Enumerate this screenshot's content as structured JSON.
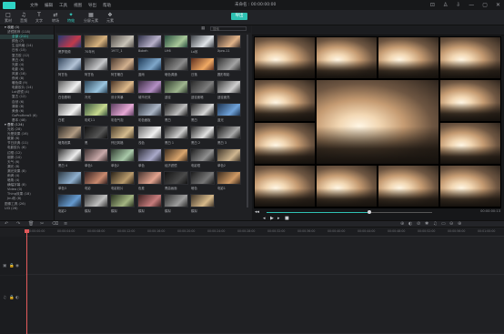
{
  "app": {
    "title": "未命名 : 00:00:00:00",
    "menu": [
      "文件",
      "编辑",
      "工具",
      "视图",
      "导出",
      "帮助"
    ],
    "win_controls": [
      "⊡",
      "♙",
      "⇩",
      "—",
      "▢",
      "✕"
    ]
  },
  "toolbar": {
    "items": [
      {
        "label": "素材",
        "icon": "□"
      },
      {
        "label": "音频",
        "icon": "♫"
      },
      {
        "label": "文字",
        "icon": "T"
      },
      {
        "label": "转场",
        "icon": "⇄"
      },
      {
        "label": "特效",
        "icon": "✦"
      },
      {
        "label": "分屏元素",
        "icon": "▦"
      },
      {
        "label": "元素",
        "icon": "❖"
      }
    ],
    "active_index": 4,
    "export_label": "导出"
  },
  "sidebar": {
    "items": [
      {
        "label": "▾ 收藏 (0)",
        "level": 0,
        "hdr": true
      },
      {
        "label": "滤镜推荐 (118)",
        "level": 1
      },
      {
        "label": "全部 (212)",
        "level": 2,
        "sel": true
      },
      {
        "label": "颜色 (7)",
        "level": 2
      },
      {
        "label": "生活风格 (14)",
        "level": 2
      },
      {
        "label": "日系 (15)",
        "level": 2
      },
      {
        "label": "复古胶 (12)",
        "level": 2
      },
      {
        "label": "黑白 (8)",
        "level": 2
      },
      {
        "label": "光影 (4)",
        "level": 2
      },
      {
        "label": "电影 (8)",
        "level": 2
      },
      {
        "label": "风景 (18)",
        "level": 2
      },
      {
        "label": "夜间 (8)",
        "level": 2
      },
      {
        "label": "暖色调 (9)",
        "level": 2
      },
      {
        "label": "电影胶片 (14)",
        "level": 2
      },
      {
        "label": "Lut滤镜 (4)",
        "level": 2
      },
      {
        "label": "复古 (12)",
        "level": 2
      },
      {
        "label": "自然 (6)",
        "level": 2
      },
      {
        "label": "清新 (8)",
        "level": 2
      },
      {
        "label": "美食 (6)",
        "level": 2
      },
      {
        "label": "GoProHero5 (6)",
        "level": 2
      },
      {
        "label": "基本 (48)",
        "level": 2
      },
      {
        "label": "▾ 叠覆 (124)",
        "level": 0,
        "hdr": true
      },
      {
        "label": "光效 (28)",
        "level": 1
      },
      {
        "label": "光晕效果 (16)",
        "level": 1
      },
      {
        "label": "散景 (6)",
        "level": 1
      },
      {
        "label": "节日庆典 (11)",
        "level": 1
      },
      {
        "label": "电影胶片 (6)",
        "level": 1
      },
      {
        "label": "边框 (12)",
        "level": 1
      },
      {
        "label": "烟雾 (10)",
        "level": 1
      },
      {
        "label": "天气 (6)",
        "level": 1
      },
      {
        "label": "漏光 (8)",
        "level": 1
      },
      {
        "label": "漏光效果 (8)",
        "level": 1
      },
      {
        "label": "雨滴 (4)",
        "level": 1
      },
      {
        "label": "暗角 (4)",
        "level": 1
      },
      {
        "label": "横幅字幕 (8)",
        "level": 1
      },
      {
        "label": "Video (0)",
        "level": 1
      },
      {
        "label": "Thing效果 (18)",
        "level": 1
      },
      {
        "label": "Jnu效 (8)",
        "level": 1
      },
      {
        "label": "图像工具 (26)",
        "level": 0
      },
      {
        "label": "UI3 (26)",
        "level": 0
      }
    ]
  },
  "browser": {
    "search_placeholder": "搜索",
    "thumbnails": [
      {
        "label": "黑梦视频",
        "a": "#243a73",
        "b": "#c23a4b"
      },
      {
        "label": "70年代",
        "a": "#4a3b2c",
        "b": "#d7b27e"
      },
      {
        "label": "1977_1",
        "a": "#514c47",
        "b": "#c8c3b8"
      },
      {
        "label": "Bokeh",
        "a": "#2c2d45",
        "b": "#b7b0c9"
      },
      {
        "label": "LH6",
        "a": "#274c3d",
        "b": "#a9c89a"
      },
      {
        "label": "Lo效",
        "a": "#3b3f44",
        "b": "#dfe3e7"
      },
      {
        "label": "Xpro-11",
        "a": "#3c2f2a",
        "b": "#e0b389"
      },
      {
        "label": "阿甘色",
        "a": "#34475d",
        "b": "#b3c3d6"
      },
      {
        "label": "阿甘色",
        "a": "#3d3e40",
        "b": "#c6c7c9"
      },
      {
        "label": "阿甘暖白",
        "a": "#47362c",
        "b": "#d2b08f"
      },
      {
        "label": "蓝雨",
        "a": "#1e3a57",
        "b": "#7ea6c9"
      },
      {
        "label": "暗色调通",
        "a": "#2d2d2d",
        "b": "#8a8a8a"
      },
      {
        "label": "日落",
        "a": "#5c2e1e",
        "b": "#f0a964"
      },
      {
        "label": "圆形阴影",
        "a": "#313131",
        "b": "#a3a3a3"
      },
      {
        "label": "白色照明",
        "a": "#5a5a5a",
        "b": "#f0f0f0"
      },
      {
        "label": "冷光",
        "a": "#2a4458",
        "b": "#9cc6e0"
      },
      {
        "label": "设计风暴",
        "a": "#4a3526",
        "b": "#ddb98b"
      },
      {
        "label": "城市光效",
        "a": "#3a2a40",
        "b": "#b38fc4"
      },
      {
        "label": "迷径",
        "a": "#2e3a2c",
        "b": "#9fb58f"
      },
      {
        "label": "迷径面暗",
        "a": "#2a2a2a",
        "b": "#7c7c7c"
      },
      {
        "label": "迷径面亮",
        "a": "#3d3d3d",
        "b": "#cfcfcf"
      },
      {
        "label": "白框",
        "a": "#6a6a6a",
        "b": "#f2f2f2"
      },
      {
        "label": "彩虹11",
        "a": "#36503c",
        "b": "#c7d98f"
      },
      {
        "label": "彩色气泡",
        "a": "#5a3d5e",
        "b": "#e6a9d5"
      },
      {
        "label": "彩色面板",
        "a": "#30363f",
        "b": "#aab5c5"
      },
      {
        "label": "黑白",
        "a": "#1e1e1e",
        "b": "#bdbdbd"
      },
      {
        "label": "黑白",
        "a": "#262626",
        "b": "#d6d6d6"
      },
      {
        "label": "蓝光",
        "a": "#1d3350",
        "b": "#6fa2d9"
      },
      {
        "label": "暗角效果",
        "a": "#2c2824",
        "b": "#b09a82"
      },
      {
        "label": "黑",
        "a": "#101010",
        "b": "#555555"
      },
      {
        "label": "怀旧风格",
        "a": "#4a3d2a",
        "b": "#d4bb8e"
      },
      {
        "label": "浅色",
        "a": "#6c6c6c",
        "b": "#efefef"
      },
      {
        "label": "黑白 1",
        "a": "#222222",
        "b": "#cccccc"
      },
      {
        "label": "黑白 2",
        "a": "#2a2a2a",
        "b": "#e0e0e0"
      },
      {
        "label": "黑白 3",
        "a": "#1a1a1a",
        "b": "#a8a8a8"
      },
      {
        "label": "黑白 4",
        "a": "#303030",
        "b": "#ededed"
      },
      {
        "label": "单色1",
        "a": "#3b2f2f",
        "b": "#c9a9a9"
      },
      {
        "label": "单色2",
        "a": "#2f3b2f",
        "b": "#a9c9a9"
      },
      {
        "label": "单色",
        "a": "#2f2f3b",
        "b": "#a9a9c9"
      },
      {
        "label": "经济滤镜",
        "a": "#3d2c1e",
        "b": "#d9a56e"
      },
      {
        "label": "电影框",
        "a": "#1f1f1f",
        "b": "#8f8f8f"
      },
      {
        "label": "单色2",
        "a": "#42382b",
        "b": "#cfb690"
      },
      {
        "label": "单色3",
        "a": "#2b3842",
        "b": "#90b0cf"
      },
      {
        "label": "电影",
        "a": "#301e1e",
        "b": "#c98a6f"
      },
      {
        "label": "电影胶片",
        "a": "#2a2218",
        "b": "#b89a6c"
      },
      {
        "label": "色差",
        "a": "#44322d",
        "b": "#e2a38f"
      },
      {
        "label": "黑曲画面",
        "a": "#121212",
        "b": "#4a4a4a"
      },
      {
        "label": "暗色",
        "a": "#1c1c1c",
        "b": "#777777"
      },
      {
        "label": "电影1",
        "a": "#3a2a1d",
        "b": "#cf9a65"
      },
      {
        "label": "电影2",
        "a": "#1d2a3a",
        "b": "#659acf"
      },
      {
        "label": "模拟",
        "a": "#3a3a3a",
        "b": "#bfbfbf"
      },
      {
        "label": "模拟",
        "a": "#28301f",
        "b": "#a3b582"
      },
      {
        "label": "模拟",
        "a": "#3b2020",
        "b": "#c67c7c"
      },
      {
        "label": "模拟",
        "a": "#2f2f2f",
        "b": "#9d9d9d"
      },
      {
        "label": "模拟",
        "a": "#403528",
        "b": "#d6b98a"
      }
    ]
  },
  "preview": {
    "timecode_top": "00:00:00:00",
    "timecode_bottom": "00:00:00:13",
    "progress": 0.62
  },
  "controls": {
    "rewind": "◂◂",
    "play": "▶",
    "forward": "▸",
    "stop": "■"
  },
  "timeline": {
    "toolbar_icons": [
      "↶",
      "↷",
      "🗑",
      "✂",
      "⌫",
      "≡"
    ],
    "right_icons": [
      "⊕",
      "◐",
      "⊘",
      "✱",
      "♫",
      "▭",
      "⊖",
      "⊕"
    ],
    "ruler": [
      "00:00:00:00",
      "00:00:04:00",
      "00:00:08:00",
      "00:00:12:00",
      "00:00:16:00",
      "00:00:20:00",
      "00:00:24:00",
      "00:00:28:00",
      "00:00:32:00",
      "00:00:36:00",
      "00:00:40:00",
      "00:00:44:00",
      "00:00:48:00",
      "00:00:52:00",
      "00:00:56:00",
      "00:01:00:00"
    ]
  }
}
